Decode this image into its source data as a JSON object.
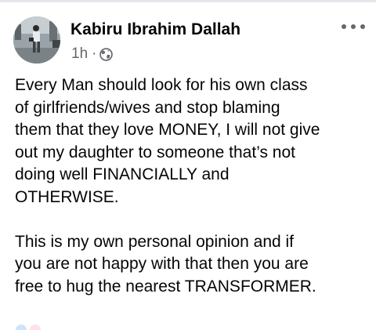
{
  "post": {
    "author": "Kabiru Ibrahim Dallah",
    "timestamp": "1h",
    "separator": "·",
    "audience_icon": "globe-icon",
    "more_icon": "more-options-icon",
    "paragraphs": [
      "Every Man should look for his own class\nof girlfriends/wives and stop blaming\nthem that they love MONEY, I will not give\nout my daughter to someone that’s not\ndoing well FINANCIALLY and\nOTHERWISE.",
      "This is my own personal opinion and if\nyou are not happy with that then you are\nfree to hug the nearest TRANSFORMER."
    ]
  },
  "colors": {
    "text": "#050505",
    "secondary_text": "#65676b",
    "divider": "#e4e6eb"
  }
}
